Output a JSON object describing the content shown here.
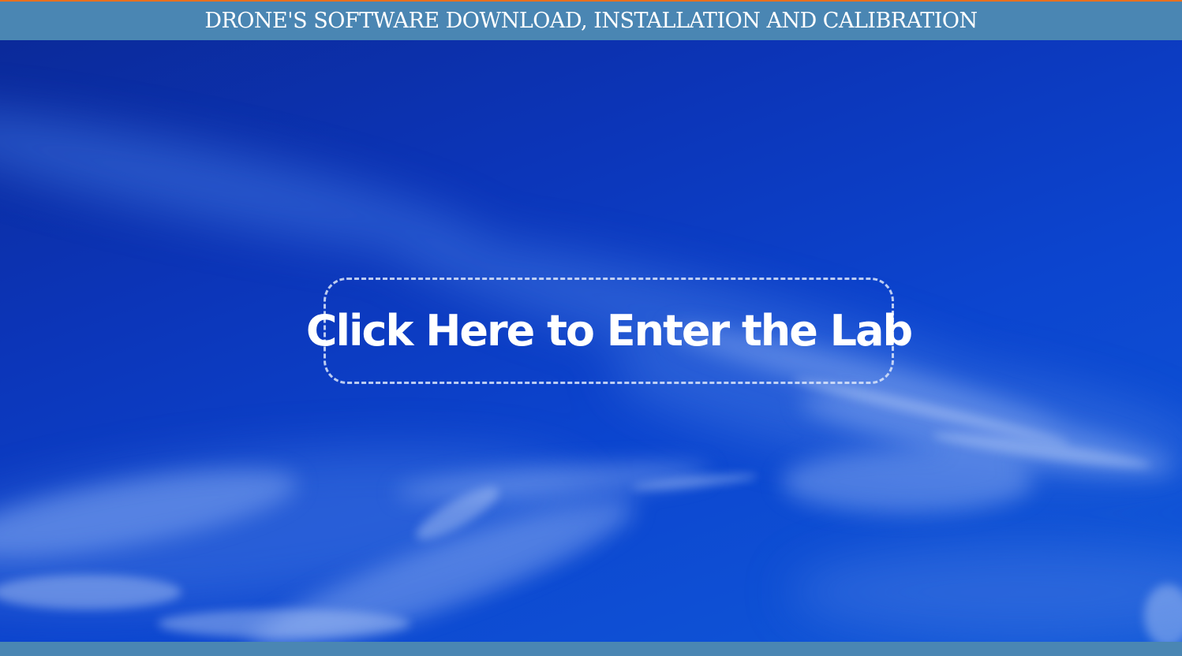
{
  "header": {
    "title": "DRONE'S SOFTWARE DOWNLOAD, INSTALLATION AND CALIBRATION"
  },
  "hero": {
    "background": "sky-with-clouds",
    "enter_button": {
      "label": "Click Here to Enter the Lab"
    }
  },
  "colors": {
    "accent": "#e8701f",
    "header_bar": "#4a86b3",
    "sky": "#0c3fc4",
    "text": "#ffffff"
  }
}
